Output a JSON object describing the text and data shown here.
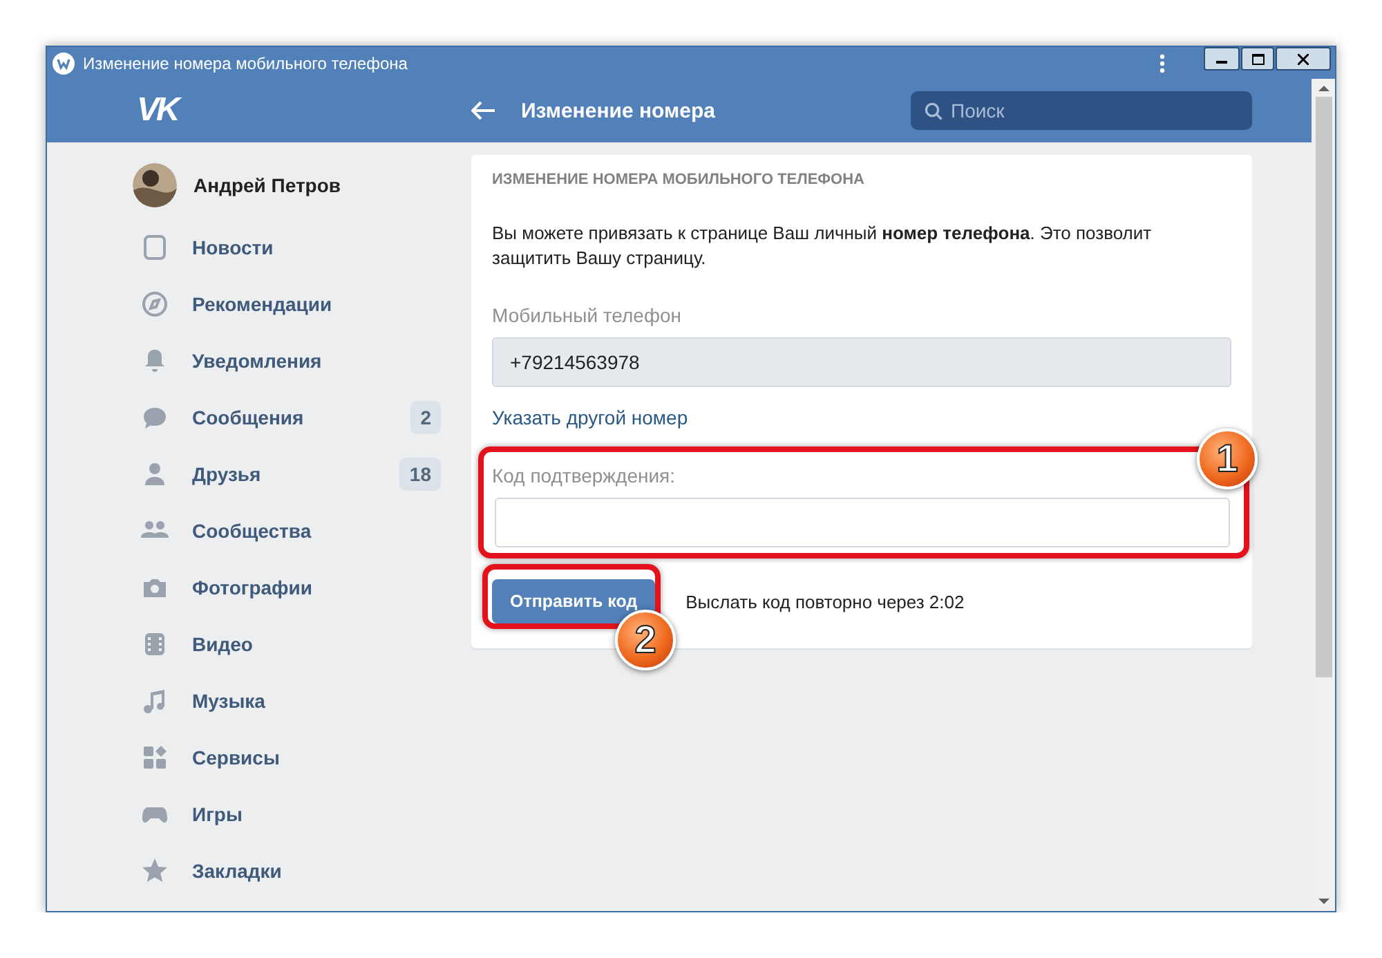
{
  "window": {
    "title": "Изменение номера мобильного телефона"
  },
  "header": {
    "logo": "VK",
    "title": "Изменение номера",
    "search": {
      "placeholder": "Поиск"
    }
  },
  "sidebar": {
    "profile": {
      "name": "Андрей Петров"
    },
    "items": [
      {
        "label": "Новости"
      },
      {
        "label": "Рекомендации"
      },
      {
        "label": "Уведомления"
      },
      {
        "label": "Сообщения",
        "badge": "2"
      },
      {
        "label": "Друзья",
        "badge": "18"
      },
      {
        "label": "Сообщества"
      },
      {
        "label": "Фотографии"
      },
      {
        "label": "Видео"
      },
      {
        "label": "Музыка"
      },
      {
        "label": "Сервисы"
      },
      {
        "label": "Игры"
      },
      {
        "label": "Закладки"
      }
    ]
  },
  "card": {
    "heading": "ИЗМЕНЕНИЕ НОМЕРА МОБИЛЬНОГО ТЕЛЕФОНА",
    "text": "Вы можете привязать к странице Ваш личный **номер телефона**. Это позволит защитить Вашу страницу.",
    "phone": {
      "label": "Мобильный телефон",
      "value": "+79214563978",
      "disabled": true
    },
    "change_link": "Указать другой номер",
    "code": {
      "label": "Код подтверждения:"
    },
    "submit_button": "Отправить код",
    "resend_text": "Выслать код повторно через 2:02"
  },
  "annotations": [
    {
      "label": "1"
    },
    {
      "label": "2"
    }
  ]
}
